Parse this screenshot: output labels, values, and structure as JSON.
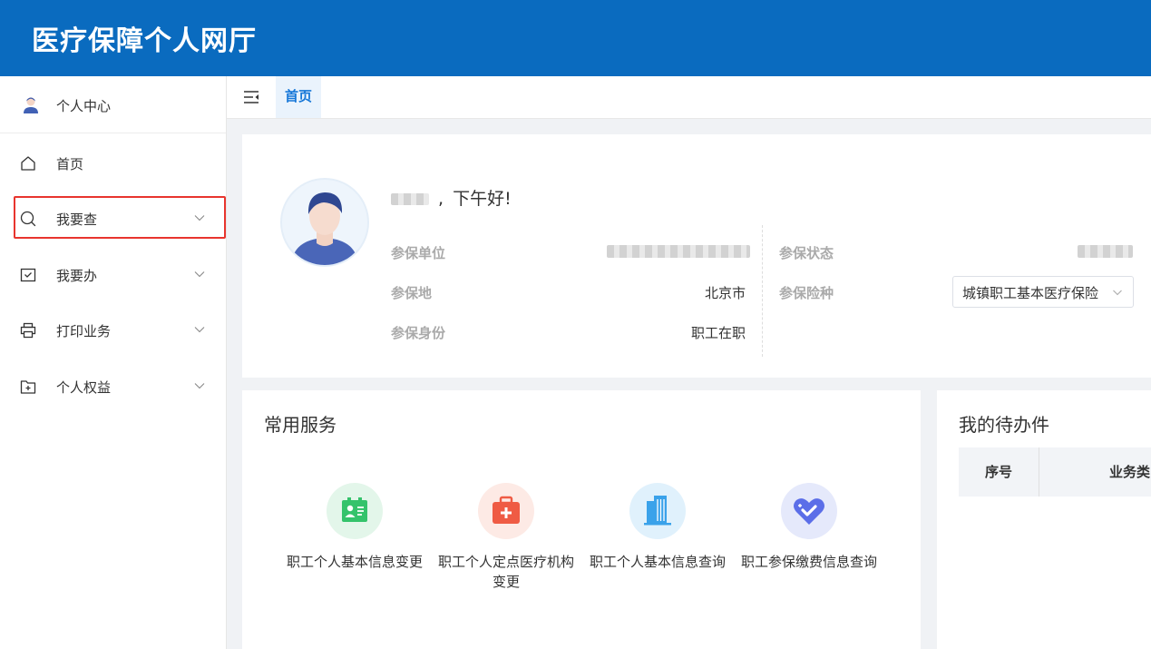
{
  "header": {
    "title": "医疗保障个人网厅"
  },
  "sidebar": {
    "user_label": "个人中心",
    "items": [
      {
        "label": "首页"
      },
      {
        "label": "我要查"
      },
      {
        "label": "我要办"
      },
      {
        "label": "打印业务"
      },
      {
        "label": "个人权益"
      }
    ]
  },
  "tabs": {
    "home": "首页"
  },
  "profile": {
    "greeting": "下午好!",
    "fields": {
      "unit_label": "参保单位",
      "status_label": "参保状态",
      "location_label": "参保地",
      "location_value": "北京市",
      "insurance_label": "参保险种",
      "insurance_value": "城镇职工基本医疗保险",
      "identity_label": "参保身份",
      "identity_value": "职工在职"
    }
  },
  "services": {
    "title": "常用服务",
    "items": [
      {
        "label": "职工个人基本信息变更"
      },
      {
        "label": "职工个人定点医疗机构变更"
      },
      {
        "label": "职工个人基本信息查询"
      },
      {
        "label": "职工参保缴费信息查询"
      }
    ]
  },
  "todo": {
    "title": "我的待办件",
    "columns": [
      "序号",
      "业务类"
    ]
  },
  "colors": {
    "brand_blue": "#0a6bbf",
    "active_tab": "#1677d8",
    "highlight_red": "#e8352e",
    "svc_green": "#34c36b",
    "svc_red": "#ef5b44",
    "svc_blue": "#3aa2ea",
    "svc_purple": "#5b6ee8"
  }
}
